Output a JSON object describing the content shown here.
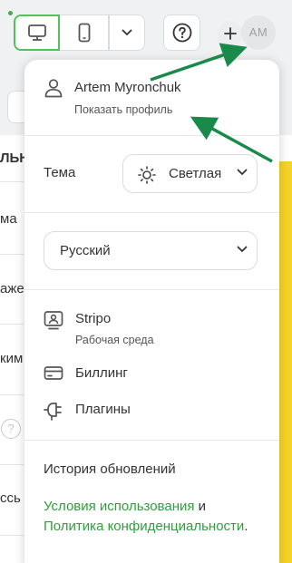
{
  "toolbar": {
    "avatar_initials": "AM",
    "icons": [
      "desktop-icon",
      "mobile-icon",
      "chevron-down-icon",
      "help-icon",
      "plus-icon"
    ]
  },
  "background": {
    "fragments": [
      "ЛЬН",
      "ма",
      "аже",
      "ким",
      "ссь"
    ]
  },
  "menu": {
    "user_name": "Artem Myronchuk",
    "profile_link": "Показать профиль",
    "theme_label": "Тема",
    "theme_value": "Светлая",
    "language_value": "Русский",
    "items": [
      {
        "label": "Stripo",
        "sublabel": "Рабочая среда",
        "icon": "workspace-icon"
      },
      {
        "label": "Биллинг",
        "icon": "billing-icon"
      },
      {
        "label": "Плагины",
        "icon": "plug-icon"
      }
    ],
    "history_link": "История обновлений",
    "legal": {
      "terms_link": "Условия использования",
      "conjunction": " и ",
      "privacy_link": "Политика конфиденциальности",
      "end": "."
    }
  },
  "colors": {
    "accent_green": "#4fc35a",
    "link_green": "#2e9f3b",
    "annotation_arrow": "#1a8a4a",
    "yellow_banner": "#f5d327"
  }
}
